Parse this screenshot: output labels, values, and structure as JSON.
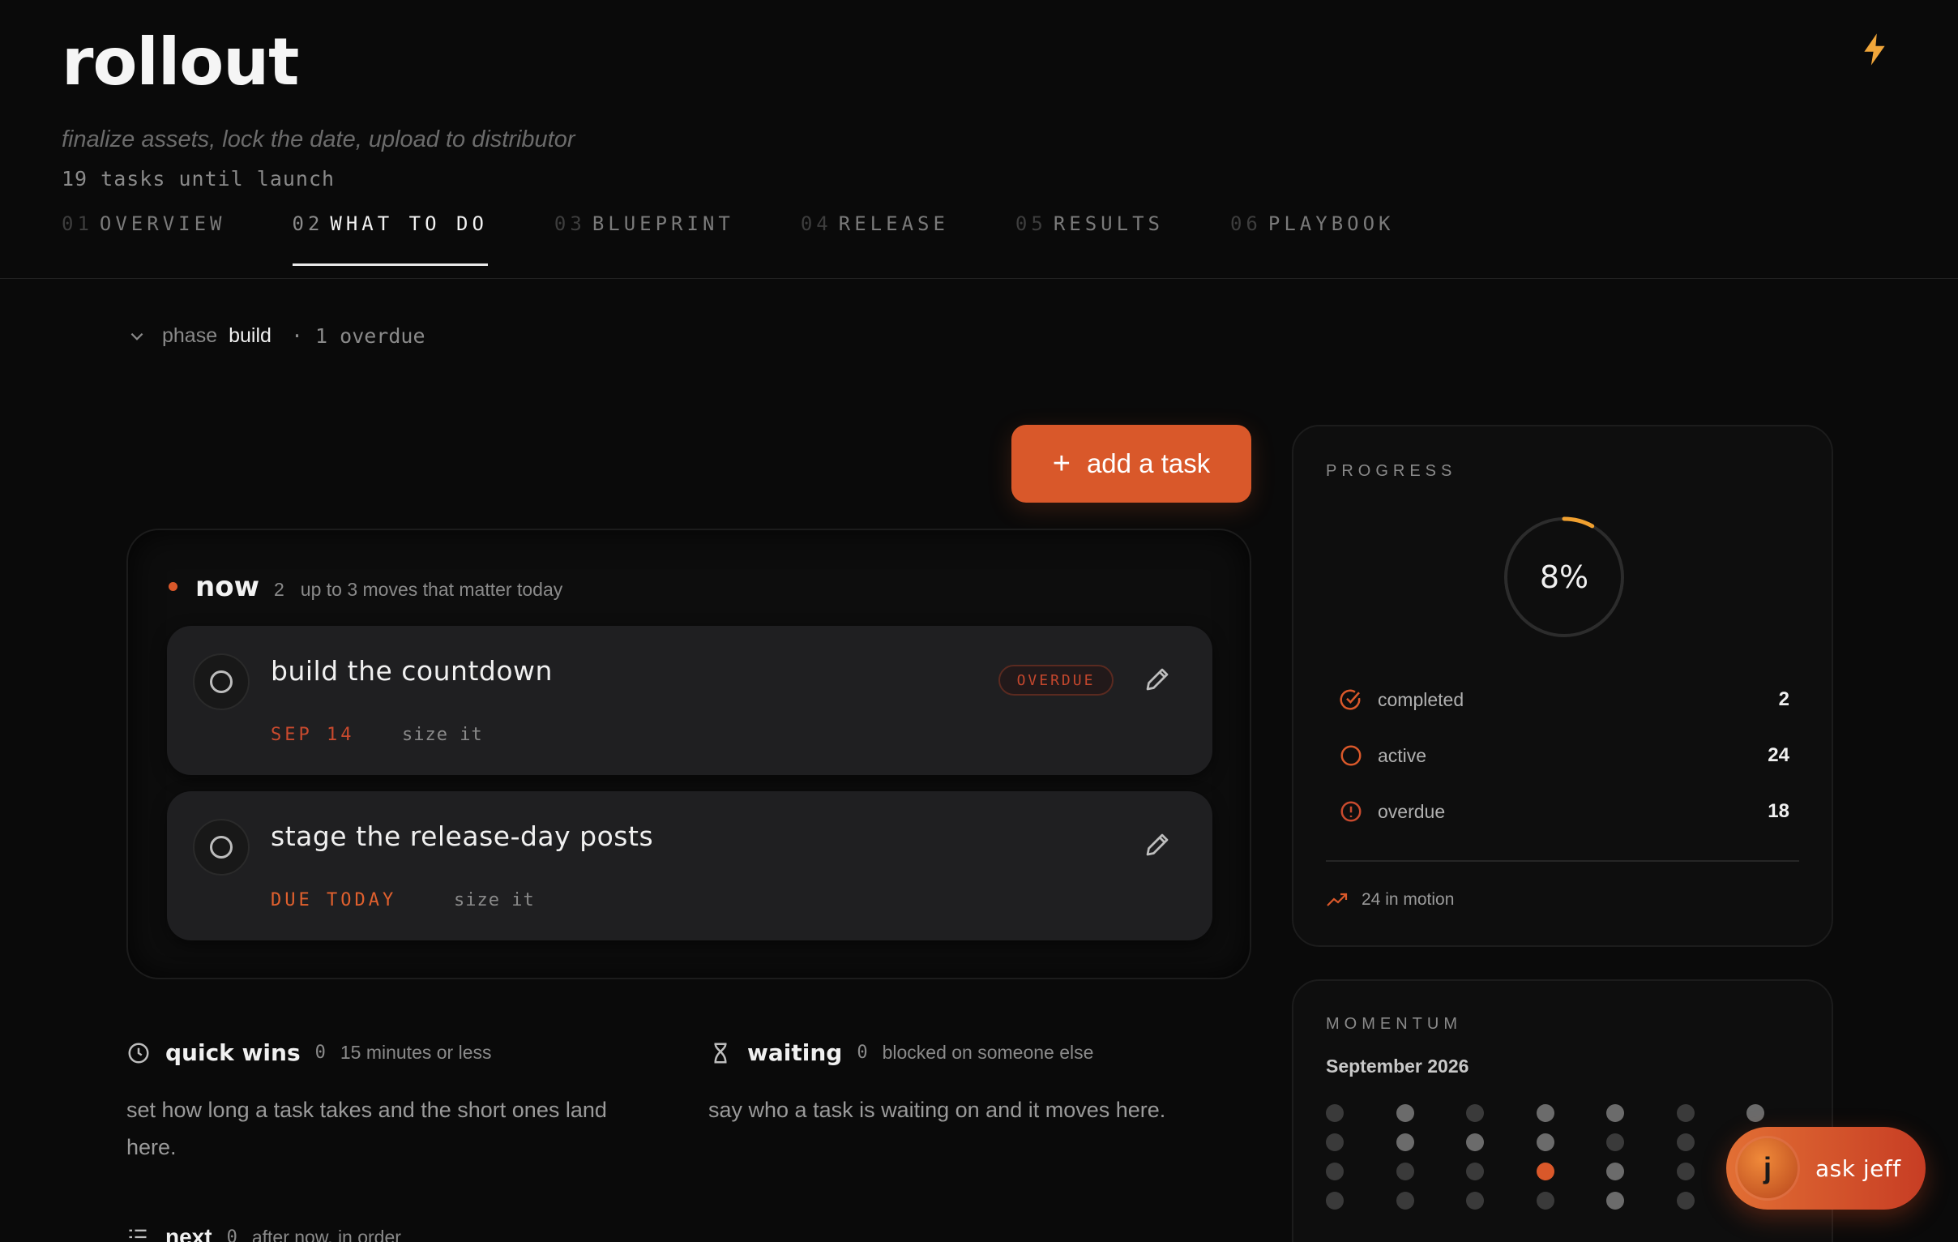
{
  "header": {
    "title": "rollout",
    "subtitle": "finalize assets, lock the date, upload to distributor",
    "task_count": "19 tasks until launch"
  },
  "tabs": [
    {
      "num": "01",
      "label": "OVERVIEW"
    },
    {
      "num": "02",
      "label": "WHAT TO DO"
    },
    {
      "num": "03",
      "label": "BLUEPRINT"
    },
    {
      "num": "04",
      "label": "RELEASE"
    },
    {
      "num": "05",
      "label": "RESULTS"
    },
    {
      "num": "06",
      "label": "PLAYBOOK"
    }
  ],
  "active_tab": "WHAT TO DO",
  "phase": {
    "label": "phase",
    "value": "build",
    "overdue": "· 1 overdue"
  },
  "add_button": {
    "icon": "+",
    "label": "add a task"
  },
  "now": {
    "title": "now",
    "count": "2",
    "description": "up to 3 moves that matter today",
    "tasks": [
      {
        "title": "build the countdown",
        "due": "SEP 14",
        "size": "size it",
        "badge": "OVERDUE"
      },
      {
        "title": "stage the release-day posts",
        "due": "DUE TODAY",
        "size": "size it",
        "badge": ""
      }
    ]
  },
  "quick_wins": {
    "title": "quick wins",
    "count": "0",
    "description": "15 minutes or less",
    "body": "set how long a task takes and the short ones land here."
  },
  "waiting": {
    "title": "waiting",
    "count": "0",
    "description": "blocked on someone else",
    "body": "say who a task is waiting on and it moves here."
  },
  "next": {
    "title": "next",
    "count": "0",
    "description": "after now, in order"
  },
  "progress": {
    "label": "PROGRESS",
    "percent_text": "8%",
    "percent": 8,
    "stats": [
      {
        "label": "completed",
        "value": "2",
        "icon": "check-circle-icon"
      },
      {
        "label": "active",
        "value": "24",
        "icon": "circle-icon"
      },
      {
        "label": "overdue",
        "value": "18",
        "icon": "alert-circle-icon"
      }
    ],
    "motion": "24 in motion"
  },
  "momentum": {
    "label": "MOMENTUM",
    "month": "September 2026",
    "grid": [
      [
        1,
        2,
        1,
        2,
        2,
        1,
        2
      ],
      [
        1,
        2,
        2,
        2,
        1,
        1,
        0
      ],
      [
        1,
        1,
        1,
        3,
        2,
        1,
        0
      ],
      [
        1,
        1,
        1,
        1,
        2,
        1,
        0
      ]
    ]
  },
  "assistant": {
    "initial": "j",
    "label": "ask jeff"
  },
  "colors": {
    "accent": "#d9582a",
    "overdue": "#c94a2e",
    "background": "#0a0a0a",
    "card": "#1f1f21"
  }
}
